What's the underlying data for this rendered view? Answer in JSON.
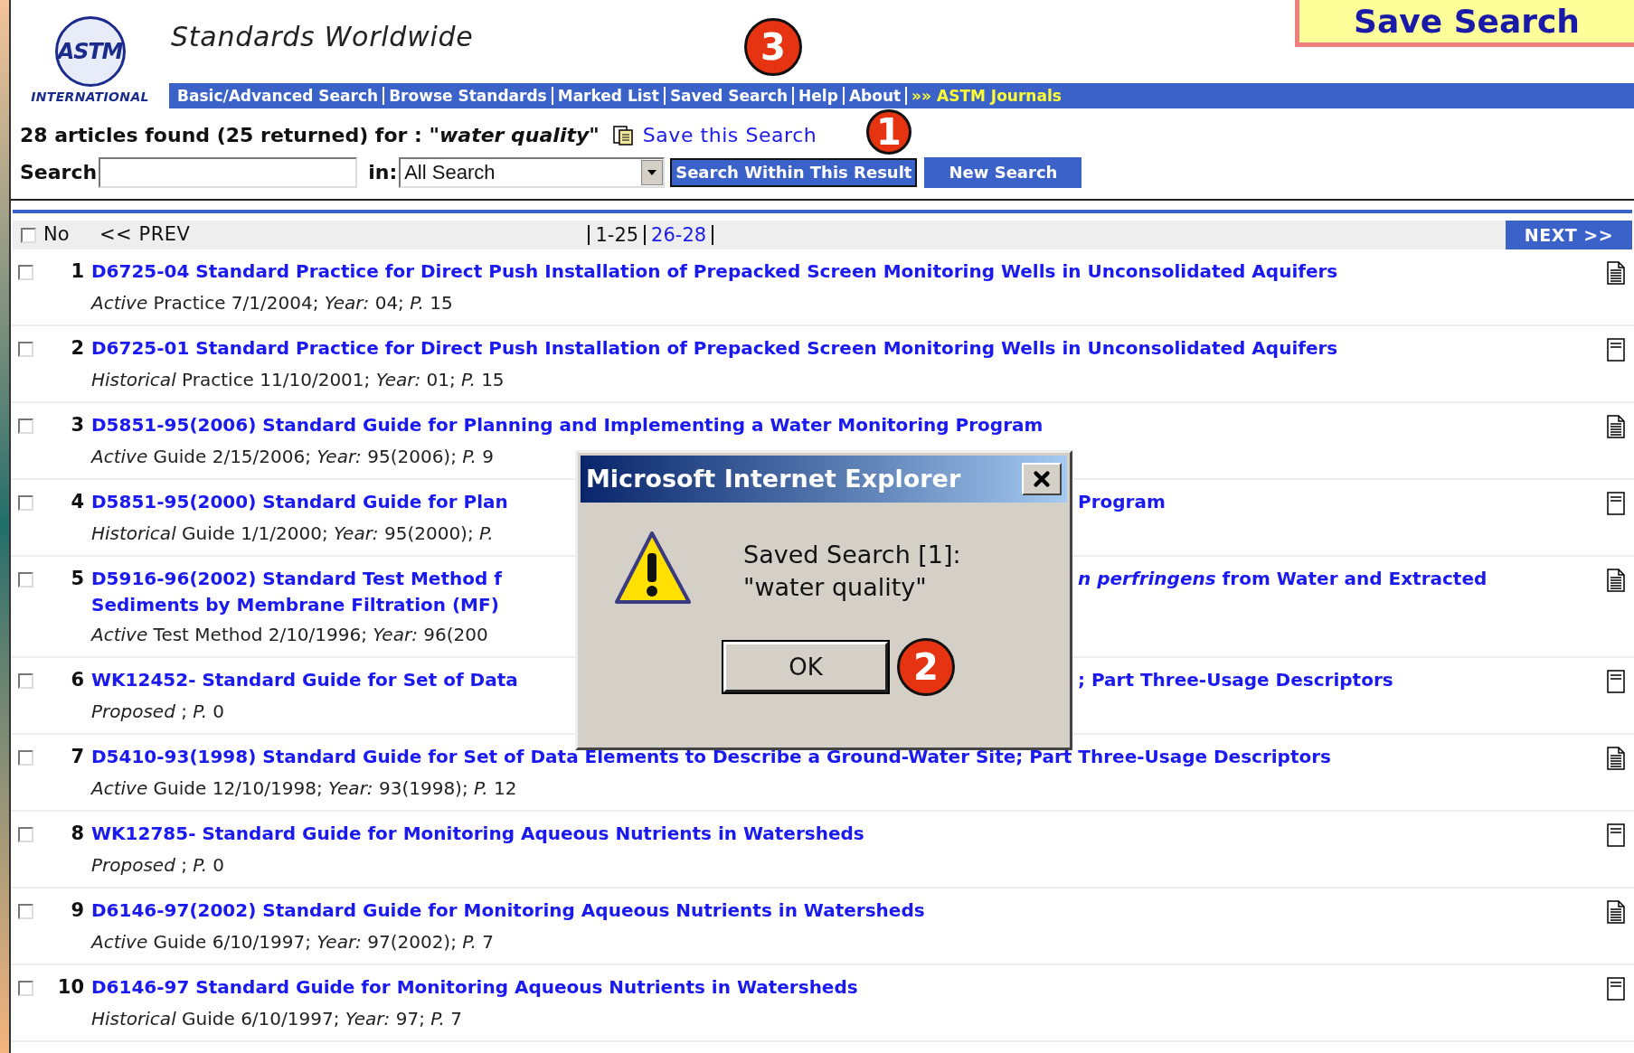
{
  "slide_title": "Save Search",
  "header": {
    "logo_text": "ASTM",
    "logo_caption": "INTERNATIONAL",
    "tagline": "Standards Worldwide"
  },
  "nav": [
    {
      "label": "Basic/Advanced Search",
      "highlight": false
    },
    {
      "label": "Browse Standards",
      "highlight": false
    },
    {
      "label": "Marked List",
      "highlight": false
    },
    {
      "label": "Saved Search",
      "highlight": false
    },
    {
      "label": "Help",
      "highlight": false
    },
    {
      "label": "About",
      "highlight": false
    },
    {
      "label": "»» ASTM Journals",
      "highlight": true
    }
  ],
  "summary": "28 articles found (25 returned) for : *\"water quality\"*",
  "save_link": "Save this Search",
  "search": {
    "label": "Search",
    "in_label": "in:",
    "scope": "All Search",
    "within_button": "Search Within This Result",
    "new_button": "New Search"
  },
  "pager": {
    "select_all_checked": false,
    "no_label": "No",
    "prev": "<< PREV",
    "pages": [
      {
        "label": "1-25",
        "selected": true
      },
      {
        "label": "26-28",
        "selected": false
      }
    ],
    "next": "NEXT >>"
  },
  "results": [
    {
      "no": "1",
      "checked": false,
      "title": "D6725-04 Standard Practice for Direct Push Installation of Prepacked Screen Monitoring Wells in Unconsolidated Aquifers",
      "meta": "*Active* Practice 7/1/2004; *Year:* 04; *P.* 15",
      "lined_icon": true
    },
    {
      "no": "2",
      "checked": false,
      "title": "D6725-01 Standard Practice for Direct Push Installation of Prepacked Screen Monitoring Wells in Unconsolidated Aquifers",
      "meta": "*Historical* Practice 11/10/2001; *Year:* 01; *P.* 15",
      "lined_icon": false
    },
    {
      "no": "3",
      "checked": false,
      "title": "D5851-95(2006) Standard Guide for Planning and Implementing a Water Monitoring Program",
      "meta": "*Active* Guide 2/15/2006; *Year:* 95(2006); *P.* 9",
      "lined_icon": true
    },
    {
      "no": "4",
      "checked": false,
      "title": "D5851-95(2000) Standard Guide for Plan",
      "title_right": "Program",
      "meta": "*Historical* Guide 1/1/2000; *Year:* 95(2000); *P.*",
      "lined_icon": false
    },
    {
      "no": "5",
      "checked": false,
      "title": "D5916-96(2002) Standard Test Method f",
      "title_right": "*n perfringens* from Water and Extracted",
      "title_line2": "Sediments by Membrane Filtration (MF)",
      "meta": "*Active* Test Method 2/10/1996; *Year:* 96(200",
      "lined_icon": true
    },
    {
      "no": "6",
      "checked": false,
      "title": "WK12452- Standard Guide for Set of Data",
      "title_right": "; Part Three-Usage Descriptors",
      "meta": "*Proposed* ; *P.* 0",
      "lined_icon": false
    },
    {
      "no": "7",
      "checked": false,
      "title": "D5410-93(1998) Standard Guide for Set of Data Elements to Describe a Ground-Water Site; Part Three-Usage Descriptors",
      "meta": "*Active* Guide 12/10/1998; *Year:* 93(1998); *P.* 12",
      "lined_icon": true
    },
    {
      "no": "8",
      "checked": false,
      "title": "WK12785- Standard Guide for Monitoring Aqueous Nutrients in Watersheds",
      "meta": "*Proposed* ; *P.* 0",
      "lined_icon": false
    },
    {
      "no": "9",
      "checked": false,
      "title": "D6146-97(2002) Standard Guide for Monitoring Aqueous Nutrients in Watersheds",
      "meta": "*Active* Guide 6/10/1997; *Year:* 97(2002); *P.* 7",
      "lined_icon": true
    },
    {
      "no": "10",
      "checked": false,
      "title": "D6146-97 Standard Guide for Monitoring Aqueous Nutrients in Watersheds",
      "meta": "*Historical* Guide 6/10/1997; *Year:* 97; *P.* 7",
      "lined_icon": false
    }
  ],
  "dialog": {
    "title": "Microsoft Internet Explorer",
    "message": [
      "Saved Search [1]:",
      "\"water quality\""
    ],
    "ok": "OK"
  },
  "callouts": [
    {
      "number": "1"
    },
    {
      "number": "2"
    },
    {
      "number": "3"
    }
  ]
}
